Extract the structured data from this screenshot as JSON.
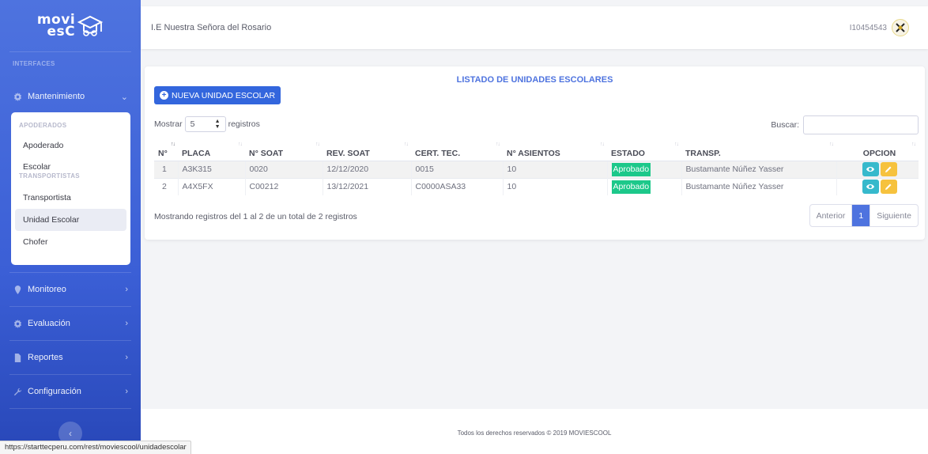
{
  "sidebar": {
    "brand": {
      "line1": "movi",
      "line2": "esC"
    },
    "heading": "INTERFACES",
    "menu": [
      {
        "label": "Mantenimiento",
        "icon": "cog-icon",
        "chevron": "⌄"
      },
      {
        "label": "Monitoreo",
        "icon": "map-pin-icon",
        "chevron": "›"
      },
      {
        "label": "Evaluación",
        "icon": "cog-icon",
        "chevron": "›"
      },
      {
        "label": "Reportes",
        "icon": "file-icon",
        "chevron": "›"
      },
      {
        "label": "Configuración",
        "icon": "wrench-icon",
        "chevron": "›"
      }
    ],
    "submenu": {
      "section1": "APODERADOS",
      "items1": [
        "Apoderado",
        "Escolar"
      ],
      "section2": "TRANSPORTISTAS",
      "items2": [
        "Transportista",
        "Unidad Escolar",
        "Chofer"
      ]
    },
    "toggle": "‹"
  },
  "topbar": {
    "school": "I.E Nuestra Señora del Rosario",
    "user": "I10454543"
  },
  "card": {
    "title": "LISTADO DE UNIDADES ESCOLARES",
    "new_button": "NUEVA UNIDAD ESCOLAR",
    "length": {
      "prefix": "Mostrar",
      "value": "5",
      "suffix": "registros"
    },
    "search_label": "Buscar:",
    "columns": [
      "N°",
      "PLACA",
      "N° SOAT",
      "REV. SOAT",
      "CERT. TEC.",
      "N° ASIENTOS",
      "ESTADO",
      "TRANSP.",
      "OPCION"
    ],
    "rows": [
      {
        "n": "1",
        "placa": "A3K315",
        "soat": "0020",
        "rev": "12/12/2020",
        "cert": "0015",
        "asientos": "10",
        "estado": "Aprobado",
        "transp": "Bustamante Núñez Yasser"
      },
      {
        "n": "2",
        "placa": "A4X5FX",
        "soat": "C00212",
        "rev": "13/12/2021",
        "cert": "C0000ASA33",
        "asientos": "10",
        "estado": "Aprobado",
        "transp": "Bustamante Núñez Yasser"
      }
    ],
    "info": "Mostrando registros del 1 al 2 de un total de 2 registros",
    "pager": {
      "prev": "Anterior",
      "current": "1",
      "next": "Siguiente"
    }
  },
  "footer": "Todos los derechos reservados © 2019 MOVIESCOOL",
  "status_url": "https://starttecperu.com/rest/moviescool/unidadescolar",
  "colors": {
    "primary": "#4e73df",
    "success": "#1cc88a",
    "info": "#36b9cc",
    "warning": "#f6c23e"
  }
}
